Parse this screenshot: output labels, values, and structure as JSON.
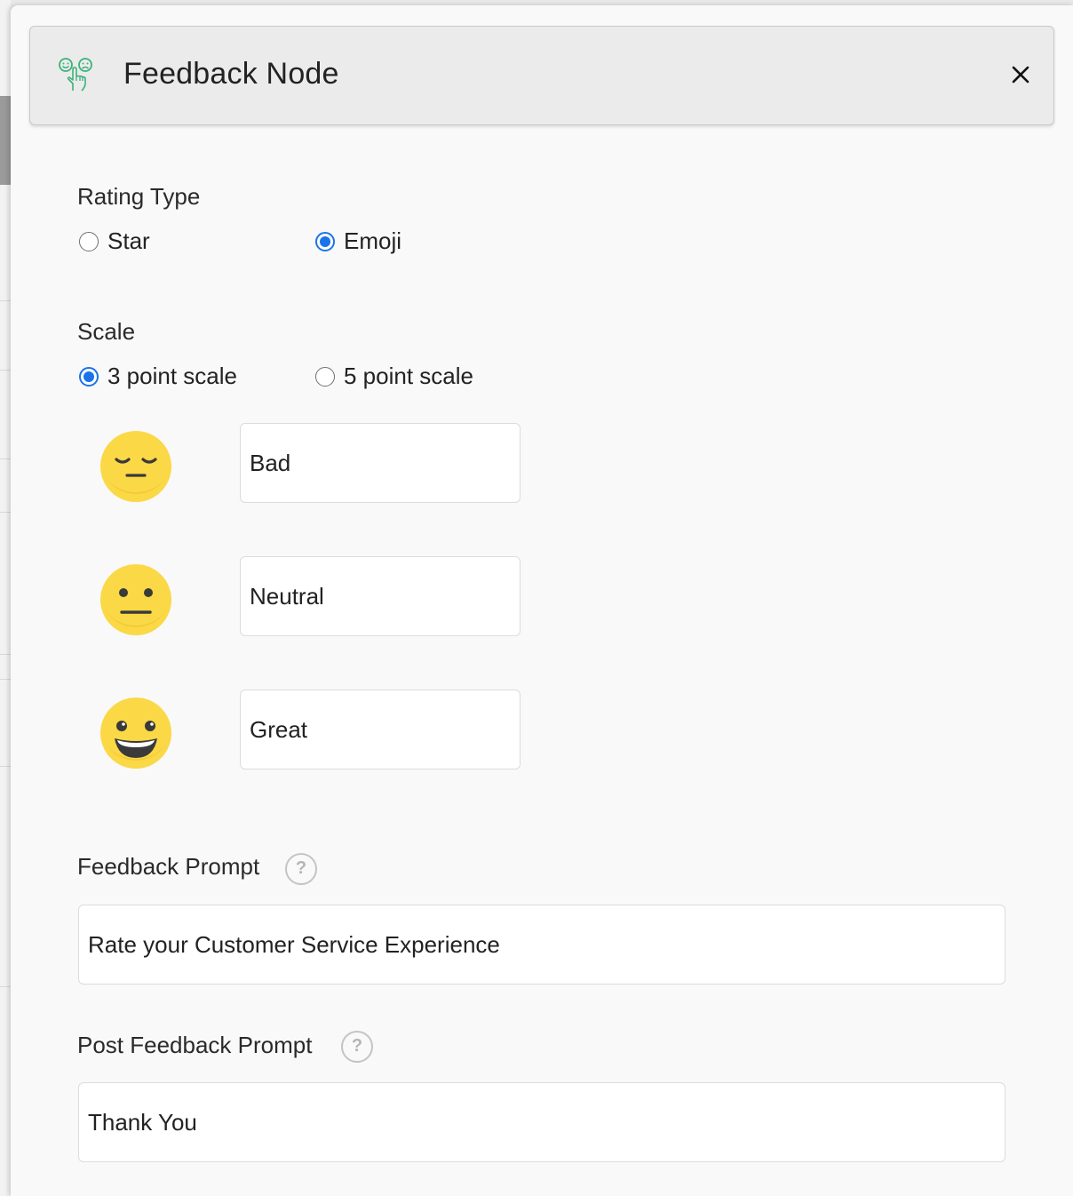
{
  "header": {
    "title": "Feedback Node",
    "icon": "feedback-node-icon",
    "close_icon": "close-icon"
  },
  "rating_type": {
    "label": "Rating Type",
    "options": [
      {
        "label": "Star",
        "checked": false
      },
      {
        "label": "Emoji",
        "checked": true
      }
    ]
  },
  "scale": {
    "label": "Scale",
    "options": [
      {
        "label": "3 point scale",
        "checked": true
      },
      {
        "label": "5 point scale",
        "checked": false
      }
    ]
  },
  "emoji_labels": [
    {
      "emoji": "sad-face-icon",
      "value": "Bad"
    },
    {
      "emoji": "neutral-face-icon",
      "value": "Neutral"
    },
    {
      "emoji": "grinning-face-icon",
      "value": "Great"
    }
  ],
  "feedback_prompt": {
    "label": "Feedback Prompt",
    "help": "?",
    "value": "Rate your Customer Service Experience"
  },
  "post_feedback_prompt": {
    "label": "Post Feedback Prompt",
    "help": "?",
    "value": "Thank You"
  },
  "colors": {
    "accent": "#1a73e8",
    "emoji_yellow": "#fbd845",
    "icon_green": "#3bb37a"
  }
}
